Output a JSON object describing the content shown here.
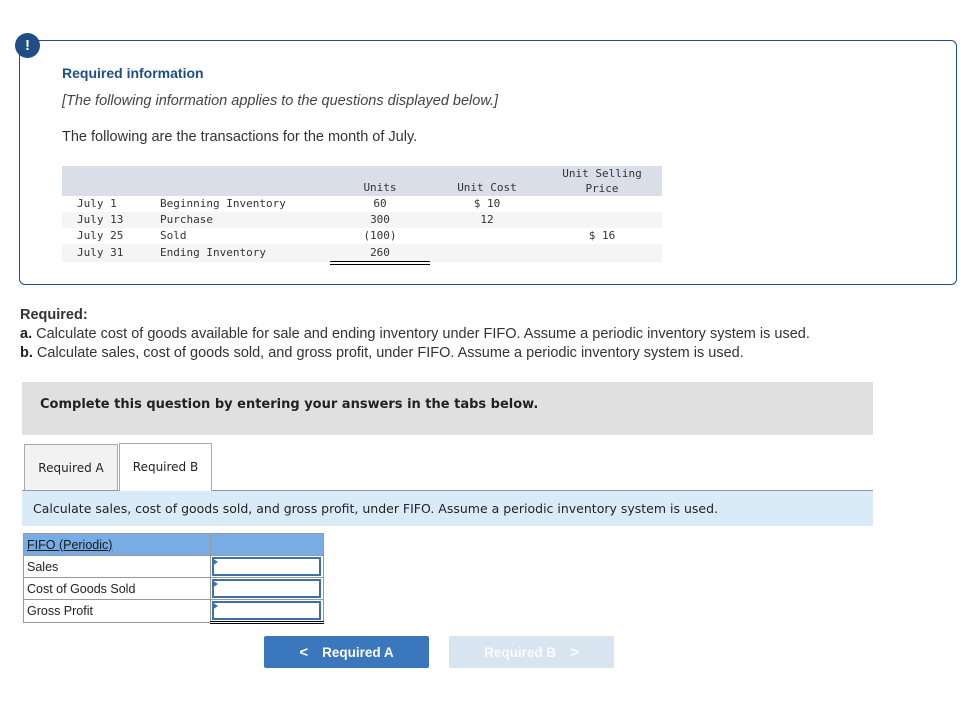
{
  "info_box": {
    "icon": "exclamation-icon",
    "icon_glyph": "!",
    "title": "Required information",
    "note": "[The following information applies to the questions displayed below.]",
    "intro": "The following are the transactions for the month of July."
  },
  "transactions": {
    "headers": {
      "units": "Units",
      "unit_cost": "Unit Cost",
      "unit_selling_price_line1": "Unit Selling",
      "unit_selling_price_line2": "Price"
    },
    "rows": [
      {
        "date": "July 1",
        "description": "Beginning Inventory",
        "units": "60",
        "unit_cost": "$ 10",
        "unit_selling_price": ""
      },
      {
        "date": "July 13",
        "description": "Purchase",
        "units": "300",
        "unit_cost": "12",
        "unit_selling_price": ""
      },
      {
        "date": "July 25",
        "description": "Sold",
        "units": "(100)",
        "unit_cost": "",
        "unit_selling_price": "$ 16"
      },
      {
        "date": "July 31",
        "description": "Ending Inventory",
        "units": "260",
        "unit_cost": "",
        "unit_selling_price": ""
      }
    ]
  },
  "required": {
    "heading": "Required:",
    "a_label": "a.",
    "a_text": "Calculate cost of goods available for sale and ending inventory under FIFO. Assume a periodic inventory system is used.",
    "b_label": "b.",
    "b_text": "Calculate sales, cost of goods sold, and gross profit, under FIFO. Assume a periodic inventory system is used."
  },
  "instruction": "Complete this question by entering your answers in the tabs below.",
  "tabs": [
    {
      "label": "Required A",
      "active": false
    },
    {
      "label": "Required B",
      "active": true
    }
  ],
  "active_tab_prompt": "Calculate sales, cost of goods sold, and gross profit, under FIFO. Assume a periodic inventory system is used.",
  "answer_table": {
    "header": "FIFO (Periodic)",
    "rows": [
      {
        "label": "Sales",
        "value": ""
      },
      {
        "label": "Cost of Goods Sold",
        "value": ""
      },
      {
        "label": "Gross Profit",
        "value": ""
      }
    ]
  },
  "nav": {
    "prev_label": "Required A",
    "prev_icon": "chevron-left-icon",
    "prev_glyph": "<",
    "next_label": "Required B",
    "next_icon": "chevron-right-icon",
    "next_glyph": ">",
    "next_disabled": true
  },
  "colors": {
    "brand_blue": "#1f4e86",
    "button_blue": "#3b77bd",
    "button_disabled": "#d9e4f1",
    "table_header_blue": "#78ace4",
    "prompt_band": "#daebf8",
    "instruction_gray": "#e0e0e0"
  }
}
